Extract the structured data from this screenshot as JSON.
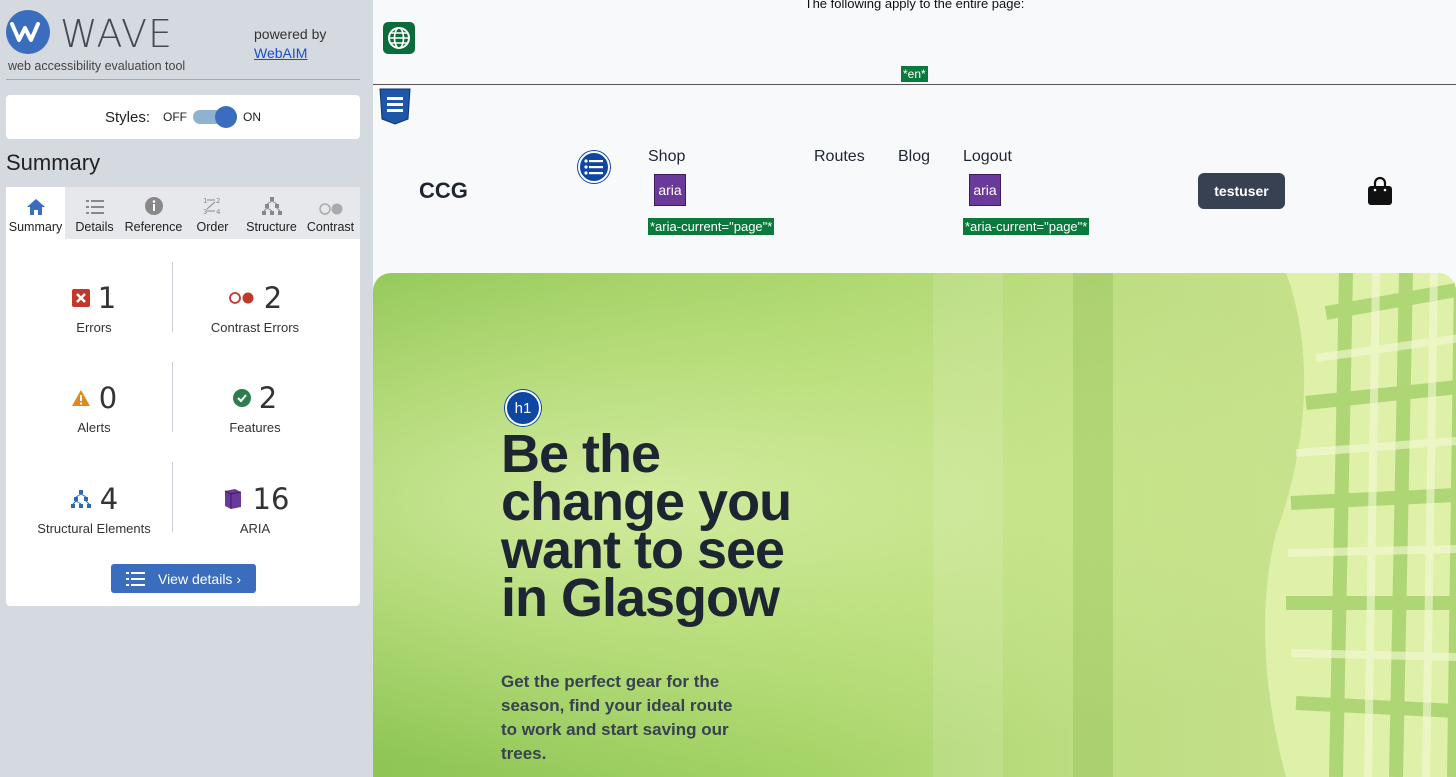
{
  "wave": {
    "logo_text": "WAVE",
    "tagline": "web accessibility evaluation tool",
    "powered_by": "powered by",
    "webaim_link": "WebAIM",
    "styles": {
      "label": "Styles:",
      "off": "OFF",
      "on": "ON"
    },
    "summary_title": "Summary",
    "tabs": [
      {
        "label": "Summary",
        "icon": "home-icon"
      },
      {
        "label": "Details",
        "icon": "list-icon"
      },
      {
        "label": "Reference",
        "icon": "info-icon"
      },
      {
        "label": "Order",
        "icon": "order-icon"
      },
      {
        "label": "Structure",
        "icon": "structure-icon"
      },
      {
        "label": "Contrast",
        "icon": "contrast-icon"
      }
    ],
    "stats": {
      "errors": {
        "count": "1",
        "label": "Errors",
        "color": "#c0392b"
      },
      "contrast_errors": {
        "count": "2",
        "label": "Contrast Errors",
        "color": "#c0392b"
      },
      "alerts": {
        "count": "0",
        "label": "Alerts",
        "color": "#e08a1e"
      },
      "features": {
        "count": "2",
        "label": "Features",
        "color": "#2e7d4f"
      },
      "structural": {
        "count": "4",
        "label": "Structural Elements",
        "color": "#2a6ab3"
      },
      "aria": {
        "count": "16",
        "label": "ARIA",
        "color": "#6a3a9a"
      }
    },
    "view_details": "View details ›"
  },
  "page": {
    "doc_notice": "The following apply to the entire page:",
    "lang_tag": "*en*",
    "brand": "CCG",
    "nav": {
      "shop": "Shop",
      "routes": "Routes",
      "blog": "Blog",
      "logout": "Logout"
    },
    "aria_badge": "aria",
    "aria_current": "*aria-current=\"page\"*",
    "user_button": "testuser",
    "h1_badge": "h1",
    "hero_title": "Be the change you want to see in Glasgow",
    "hero_subtitle": "Get the perfect gear for the season, find your ideal route to work and start saving our trees."
  }
}
